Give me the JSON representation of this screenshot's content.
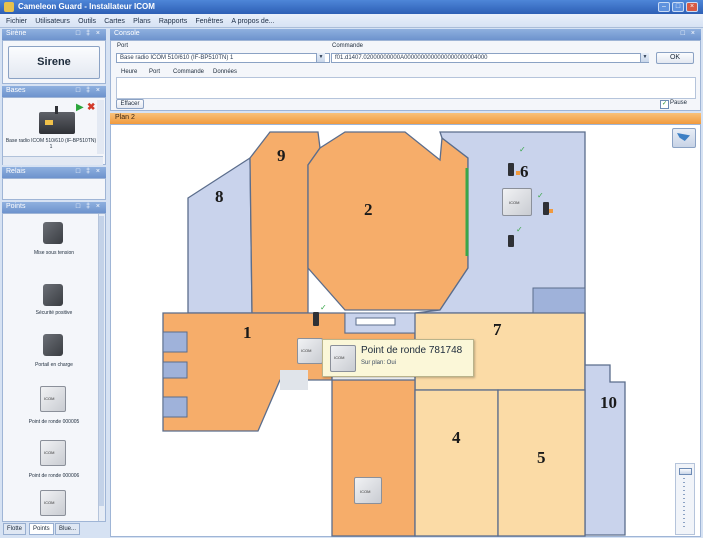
{
  "window": {
    "title": "Cameleon Guard - Installateur ICOM"
  },
  "menu": [
    "Fichier",
    "Utilisateurs",
    "Outils",
    "Cartes",
    "Plans",
    "Rapports",
    "Fenêtres",
    "A propos de..."
  ],
  "sirene": {
    "header": "Sirène",
    "button_label": "Sirene"
  },
  "bases": {
    "header": "Bases",
    "item_label": "Base radio ICOM 510/610 (IF-BP510TN) 1"
  },
  "relais": {
    "header": "Relais"
  },
  "points": {
    "header": "Points",
    "items": [
      "Mise sous tension",
      "Sécurité positive",
      "Portail en charge",
      "Point de ronde 000005",
      "Point de ronde 000006"
    ]
  },
  "bottom_tabs": [
    "Flotte",
    "Points",
    "Blue..."
  ],
  "console": {
    "header": "Console",
    "port_label": "Port",
    "port_value": "Base radio ICOM 510/610 (IF-BP510TN) 1",
    "commande_label": "Commande",
    "commande_value": "f01.d1407.02000000000A0000000000000000000004000",
    "ok_label": "OK",
    "log_columns": [
      "Heure",
      "Port",
      "Commande",
      "Données"
    ],
    "effacer_label": "Effacer",
    "pause_label": "Pause",
    "pause_checked": true
  },
  "plan": {
    "tab_title": "Plan 2",
    "rooms": [
      "1",
      "2",
      "4",
      "5",
      "6",
      "7",
      "8",
      "9",
      "10"
    ],
    "device_label": "ICOM",
    "tooltip": {
      "title": "Point de ronde 781748",
      "subtitle": "Sur plan: Oui"
    }
  },
  "colors": {
    "accent": "#f5a94e",
    "room_orange": "#f6ad6a",
    "room_light": "#fbdba6",
    "room_blue": "#c9d3ec"
  }
}
